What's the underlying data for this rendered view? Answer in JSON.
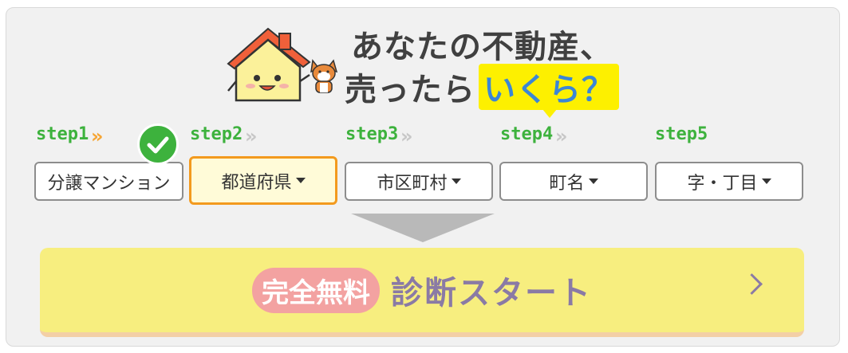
{
  "header": {
    "title_line1": "あなたの不動産、",
    "title_line2": "売ったら",
    "title_highlight": "いくら？"
  },
  "steps": [
    {
      "label": "step1",
      "value": "分譲マンション",
      "state": "done"
    },
    {
      "label": "step2",
      "value": "都道府県",
      "state": "active"
    },
    {
      "label": "step3",
      "value": "市区町村",
      "state": "pending"
    },
    {
      "label": "step4",
      "value": "町名",
      "state": "pending"
    },
    {
      "label": "step5",
      "value": "字・丁目",
      "state": "pending"
    }
  ],
  "start_button": {
    "badge": "完全無料",
    "label": "診断スタート"
  },
  "colors": {
    "green": "#3db23d",
    "orange": "#f39a1e",
    "yellow": "#fdf000",
    "blue": "#3b86d6",
    "button": "#f7ee7f",
    "badge": "#f3a2a1"
  },
  "icons": [
    "house-mascot-icon",
    "dog-mascot-icon",
    "check-icon",
    "chevron-right-icon"
  ]
}
